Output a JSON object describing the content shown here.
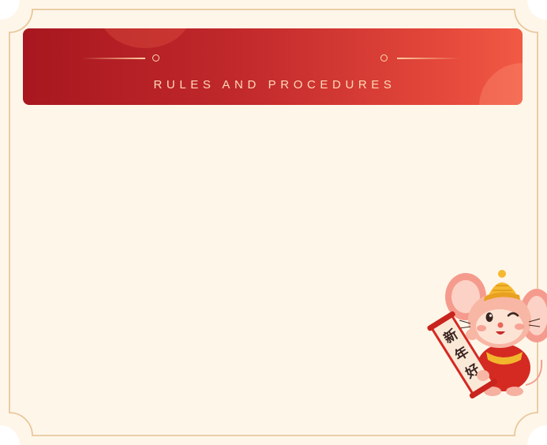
{
  "header": {
    "title": "RULES AND PROCEDURES"
  },
  "mascot": {
    "banner_text": "新年好"
  },
  "colors": {
    "panel_background": "#fff6ea",
    "frame_border": "#e8c89c",
    "header_gradient_start": "#a8171f",
    "header_gradient_end": "#f15a45",
    "title_text": "#ffd9b8"
  }
}
